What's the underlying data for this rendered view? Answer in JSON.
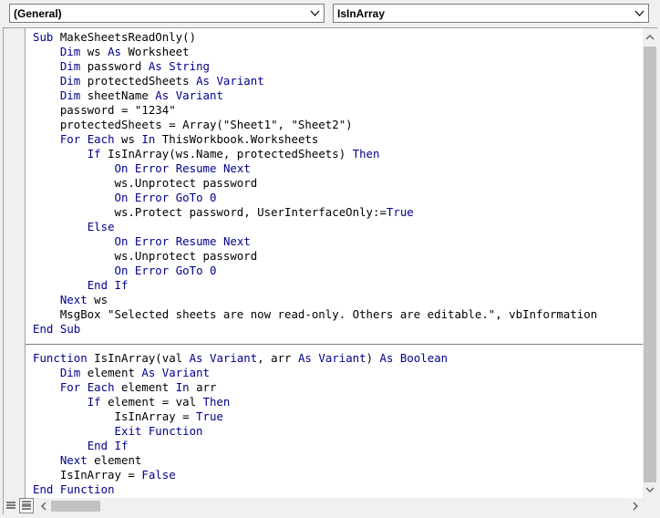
{
  "object_combo": {
    "value": "(General)"
  },
  "procedure_combo": {
    "value": "IsInArray"
  },
  "code_lines": [
    [
      {
        "t": "Sub",
        "k": 1
      },
      {
        "t": " MakeSheetsReadOnly()",
        "k": 0
      }
    ],
    [
      {
        "t": "    ",
        "k": 0
      },
      {
        "t": "Dim",
        "k": 1
      },
      {
        "t": " ws ",
        "k": 0
      },
      {
        "t": "As",
        "k": 1
      },
      {
        "t": " Worksheet",
        "k": 0
      }
    ],
    [
      {
        "t": "    ",
        "k": 0
      },
      {
        "t": "Dim",
        "k": 1
      },
      {
        "t": " password ",
        "k": 0
      },
      {
        "t": "As",
        "k": 1
      },
      {
        "t": " ",
        "k": 0
      },
      {
        "t": "String",
        "k": 1
      }
    ],
    [
      {
        "t": "    ",
        "k": 0
      },
      {
        "t": "Dim",
        "k": 1
      },
      {
        "t": " protectedSheets ",
        "k": 0
      },
      {
        "t": "As",
        "k": 1
      },
      {
        "t": " ",
        "k": 0
      },
      {
        "t": "Variant",
        "k": 1
      }
    ],
    [
      {
        "t": "    ",
        "k": 0
      },
      {
        "t": "Dim",
        "k": 1
      },
      {
        "t": " sheetName ",
        "k": 0
      },
      {
        "t": "As",
        "k": 1
      },
      {
        "t": " ",
        "k": 0
      },
      {
        "t": "Variant",
        "k": 1
      }
    ],
    [
      {
        "t": "    password = \"1234\"",
        "k": 0
      }
    ],
    [
      {
        "t": "    protectedSheets = Array(\"Sheet1\", \"Sheet2\")",
        "k": 0
      }
    ],
    [
      {
        "t": "    ",
        "k": 0
      },
      {
        "t": "For",
        "k": 1
      },
      {
        "t": " ",
        "k": 0
      },
      {
        "t": "Each",
        "k": 1
      },
      {
        "t": " ws ",
        "k": 0
      },
      {
        "t": "In",
        "k": 1
      },
      {
        "t": " ThisWorkbook.Worksheets",
        "k": 0
      }
    ],
    [
      {
        "t": "        ",
        "k": 0
      },
      {
        "t": "If",
        "k": 1
      },
      {
        "t": " IsInArray(ws.Name, protectedSheets) ",
        "k": 0
      },
      {
        "t": "Then",
        "k": 1
      }
    ],
    [
      {
        "t": "            ",
        "k": 0
      },
      {
        "t": "On",
        "k": 1
      },
      {
        "t": " ",
        "k": 0
      },
      {
        "t": "Error",
        "k": 1
      },
      {
        "t": " ",
        "k": 0
      },
      {
        "t": "Resume",
        "k": 1
      },
      {
        "t": " ",
        "k": 0
      },
      {
        "t": "Next",
        "k": 1
      }
    ],
    [
      {
        "t": "            ws.Unprotect password",
        "k": 0
      }
    ],
    [
      {
        "t": "            ",
        "k": 0
      },
      {
        "t": "On",
        "k": 1
      },
      {
        "t": " ",
        "k": 0
      },
      {
        "t": "Error",
        "k": 1
      },
      {
        "t": " ",
        "k": 0
      },
      {
        "t": "GoTo",
        "k": 1
      },
      {
        "t": " ",
        "k": 0
      },
      {
        "t": "0",
        "k": 1
      }
    ],
    [
      {
        "t": "            ws.Protect password, UserInterfaceOnly:=",
        "k": 0
      },
      {
        "t": "True",
        "k": 1
      }
    ],
    [
      {
        "t": "        ",
        "k": 0
      },
      {
        "t": "Else",
        "k": 1
      }
    ],
    [
      {
        "t": "            ",
        "k": 0
      },
      {
        "t": "On",
        "k": 1
      },
      {
        "t": " ",
        "k": 0
      },
      {
        "t": "Error",
        "k": 1
      },
      {
        "t": " ",
        "k": 0
      },
      {
        "t": "Resume",
        "k": 1
      },
      {
        "t": " ",
        "k": 0
      },
      {
        "t": "Next",
        "k": 1
      }
    ],
    [
      {
        "t": "            ws.Unprotect password",
        "k": 0
      }
    ],
    [
      {
        "t": "            ",
        "k": 0
      },
      {
        "t": "On",
        "k": 1
      },
      {
        "t": " ",
        "k": 0
      },
      {
        "t": "Error",
        "k": 1
      },
      {
        "t": " ",
        "k": 0
      },
      {
        "t": "GoTo",
        "k": 1
      },
      {
        "t": " ",
        "k": 0
      },
      {
        "t": "0",
        "k": 1
      }
    ],
    [
      {
        "t": "        ",
        "k": 0
      },
      {
        "t": "End",
        "k": 1
      },
      {
        "t": " ",
        "k": 0
      },
      {
        "t": "If",
        "k": 1
      }
    ],
    [
      {
        "t": "    ",
        "k": 0
      },
      {
        "t": "Next",
        "k": 1
      },
      {
        "t": " ws",
        "k": 0
      }
    ],
    [
      {
        "t": "    MsgBox \"Selected sheets are now read-only. Others are editable.\", vbInformation",
        "k": 0
      }
    ],
    [
      {
        "t": "End",
        "k": 1
      },
      {
        "t": " ",
        "k": 0
      },
      {
        "t": "Sub",
        "k": 1
      }
    ],
    [],
    [
      {
        "t": "Function",
        "k": 1
      },
      {
        "t": " IsInArray(val ",
        "k": 0
      },
      {
        "t": "As",
        "k": 1
      },
      {
        "t": " ",
        "k": 0
      },
      {
        "t": "Variant",
        "k": 1
      },
      {
        "t": ", arr ",
        "k": 0
      },
      {
        "t": "As",
        "k": 1
      },
      {
        "t": " ",
        "k": 0
      },
      {
        "t": "Variant",
        "k": 1
      },
      {
        "t": ") ",
        "k": 0
      },
      {
        "t": "As",
        "k": 1
      },
      {
        "t": " ",
        "k": 0
      },
      {
        "t": "Boolean",
        "k": 1
      }
    ],
    [
      {
        "t": "    ",
        "k": 0
      },
      {
        "t": "Dim",
        "k": 1
      },
      {
        "t": " element ",
        "k": 0
      },
      {
        "t": "As",
        "k": 1
      },
      {
        "t": " ",
        "k": 0
      },
      {
        "t": "Variant",
        "k": 1
      }
    ],
    [
      {
        "t": "    ",
        "k": 0
      },
      {
        "t": "For",
        "k": 1
      },
      {
        "t": " ",
        "k": 0
      },
      {
        "t": "Each",
        "k": 1
      },
      {
        "t": " element ",
        "k": 0
      },
      {
        "t": "In",
        "k": 1
      },
      {
        "t": " arr",
        "k": 0
      }
    ],
    [
      {
        "t": "        ",
        "k": 0
      },
      {
        "t": "If",
        "k": 1
      },
      {
        "t": " element = val ",
        "k": 0
      },
      {
        "t": "Then",
        "k": 1
      }
    ],
    [
      {
        "t": "            IsInArray = ",
        "k": 0
      },
      {
        "t": "True",
        "k": 1
      }
    ],
    [
      {
        "t": "            ",
        "k": 0
      },
      {
        "t": "Exit",
        "k": 1
      },
      {
        "t": " ",
        "k": 0
      },
      {
        "t": "Function",
        "k": 1
      }
    ],
    [
      {
        "t": "        ",
        "k": 0
      },
      {
        "t": "End",
        "k": 1
      },
      {
        "t": " ",
        "k": 0
      },
      {
        "t": "If",
        "k": 1
      }
    ],
    [
      {
        "t": "    ",
        "k": 0
      },
      {
        "t": "Next",
        "k": 1
      },
      {
        "t": " element",
        "k": 0
      }
    ],
    [
      {
        "t": "    IsInArray = ",
        "k": 0
      },
      {
        "t": "False",
        "k": 1
      }
    ],
    [
      {
        "t": "End",
        "k": 1
      },
      {
        "t": " ",
        "k": 0
      },
      {
        "t": "Function",
        "k": 1
      }
    ]
  ],
  "colors": {
    "keyword": "#00008b",
    "text": "#000000",
    "background": "#ffffff",
    "chrome": "#f0f0f0",
    "scroll_thumb": "#c2c2c2"
  },
  "icons": {
    "combo_arrow": "chevron-down-icon",
    "scroll_up": "arrow-up-icon",
    "scroll_down": "arrow-down-icon",
    "scroll_left": "arrow-left-icon",
    "scroll_right": "arrow-right-icon",
    "procedure_view": "procedure-view-icon",
    "full_module_view": "full-module-view-icon"
  }
}
